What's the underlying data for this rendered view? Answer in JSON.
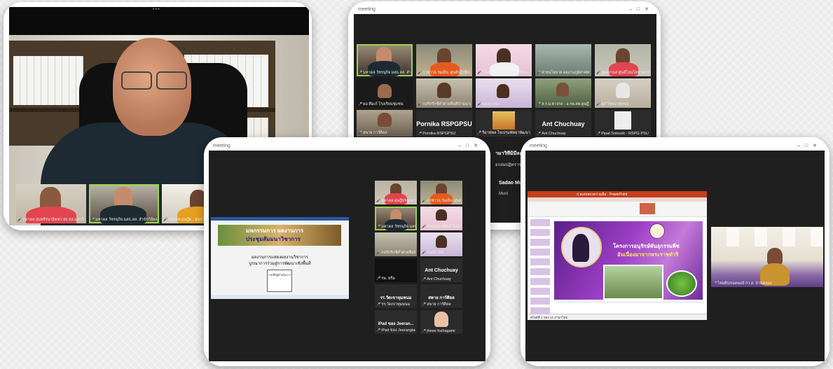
{
  "card1": {
    "top_dots": "• • •",
    "thumbnails": [
      {
        "name": "มหาดล สุนทรีรนาธิคชา สธ.สส.มหาวิ ศรีวิชัย"
      },
      {
        "name": "มหาดล วัชรนุกิจ มสธ.สส. สำนักวิจัยและ"
      },
      {
        "name": "มหาดล ดุษฎีต.. สุขภาพลึกบุรี.รพ.สต.ใน"
      }
    ]
  },
  "card2": {
    "title": "meeting",
    "tiles": [
      {
        "name": "มหาดล วัชรนุกิจ มสธ.สส. สำนักวิจัย",
        "big": ""
      },
      {
        "name": "กาชาวธ.ร่มเย็บ..ศูนย์ปฏิบัติการวิจัย",
        "big": ""
      },
      {
        "name": "ไปอนุญาตพันธ์ ไผ่สกุลวิทยะ",
        "big": ""
      },
      {
        "name": "ฝ่ายนโยบาย ผลงานภูมิศาสตร์",
        "big": ""
      },
      {
        "name": "ดูผลงานส่ ศูนย์ไปนโยบายการบริหาร",
        "big": ""
      },
      {
        "name": "ผอ.ทีมเก้ โรงเรียนชุมชน",
        "big": ""
      },
      {
        "name": "กอรักรักซ์คำฝ่ายพื้นที่บ้านนาอ",
        "big": ""
      },
      {
        "name": "ปลงการณ",
        "big": ""
      },
      {
        "name": "ส.ร.ม.ทางรถ - อ.รพ.สต.ดุษฎี ตำบล",
        "big": ""
      },
      {
        "name": "ศุภิ ไชยอาศุพนม",
        "big": ""
      },
      {
        "name": "สพาย การ์ศิลล",
        "big": ""
      },
      {
        "name": "Pornika RSPGPSU",
        "big": "Pornika RSPGPSU"
      },
      {
        "name": "รีดาทพล ใจเปรมพัทยาพัฒนาผู้ดิน",
        "big": ""
      },
      {
        "name": "Ant Chuchuay",
        "big": "Ant Chuchuay"
      },
      {
        "name": "Pipat Sotsook - RSPG-PSU",
        "big": ""
      }
    ],
    "partial": [
      {
        "text": "ามาวิทีมิมีละพันธุร..."
      },
      {
        "text": "ยกล่มปฏิทราชภูมินาร"
      },
      {
        "text": "Sadao Muni"
      },
      {
        "text": "Muni"
      }
    ]
  },
  "card3": {
    "title": "meeting",
    "doc": {
      "banner_line1": "มหกรรมการ ผลงานการ",
      "banner_line2": "ประชุมสัมมนาวิชาการ",
      "heading_line1": "ผลงานการแสดงผลงานวิชาการ",
      "heading_line2": "บูรณาการร่วมสู่การพัฒนาเชิงพื้นที่",
      "box_text": "รายชื่อผู้ดำเนินการ"
    },
    "tiles": [
      {
        "name": "มหาดล ดุษฎีปรยูกงานเมืองนคร",
        "big": ""
      },
      {
        "name": "กาชาวธ.ร่มเย็บ..ศูนย์ปฏิบัติ",
        "big": ""
      },
      {
        "name": "มหาดล วัชรนุกิจ มสธ.สส. สรรม",
        "big": ""
      },
      {
        "name": "ไปอนุญาตพันธ์ ไผ่สกุล 1..",
        "big": ""
      },
      {
        "name": "กอรักรักซ์คำฝ่ายพื้นที่บ้าน/ร",
        "big": ""
      },
      {
        "name": "ปลงการณ",
        "big": ""
      },
      {
        "name": "รพ. หรือ",
        "big": ""
      },
      {
        "name": "Ant Chuchuay",
        "big": "Ant Chuchuay"
      },
      {
        "name": "รร.วัดเขาทุมพนม",
        "big": "รร.วัดเขาทุมพนม"
      },
      {
        "name": "สพาย การ์ศิลล",
        "big": "สพาย การ์ศิลล"
      },
      {
        "name": "iPad ของ Jeerangtan",
        "big": "iPad ของ Jeeran..."
      },
      {
        "name": "jheee fozhagami",
        "big": ""
      }
    ]
  },
  "card4": {
    "title": "meeting",
    "ppt_title": "กุ คเค่งพรรคร่วมมือ - PowerPoint",
    "slide_title_line1": "โครงการอนุรักษ์พันธุกรรมพืช",
    "slide_title_line2": "อันเนื่องมาจากพระราชดำริ",
    "status_left": "สไลด์ที่ 1 ของ 13 ภาษาไทย",
    "speaker_name": "ไชยดินขนดพงษ์ กา.ส. บ้านคลอง"
  },
  "colors": {
    "zoom_bg": "#1f1f1f",
    "active_speaker": "#9bd34b",
    "ppt_red": "#c43e1c",
    "slide_purple": "#7b2aa6"
  }
}
